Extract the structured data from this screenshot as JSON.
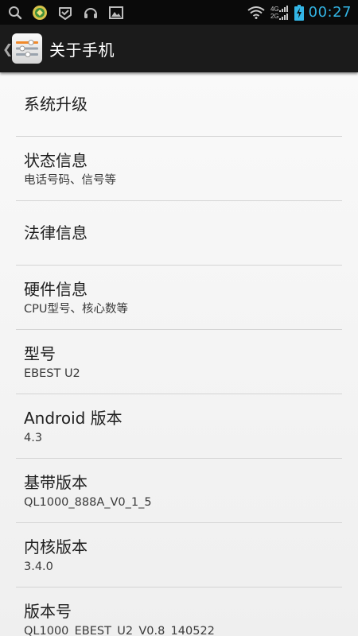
{
  "status_bar": {
    "left_icons": [
      "search-icon",
      "app-notification-icon",
      "mail-check-icon",
      "headset-icon",
      "gallery-icon"
    ],
    "network": {
      "line1": "4G",
      "line2": "2G"
    },
    "time": "00:27",
    "accent_color": "#33b5e5"
  },
  "action_bar": {
    "title": "关于手机",
    "up_chevron": "❮",
    "background": "#1b1b1b"
  },
  "settings": {
    "items": [
      {
        "title": "系统升级",
        "summary": ""
      },
      {
        "title": "状态信息",
        "summary": "电话号码、信号等"
      },
      {
        "title": "法律信息",
        "summary": ""
      },
      {
        "title": "硬件信息",
        "summary": "CPU型号、核心数等"
      },
      {
        "title": "型号",
        "summary": "EBEST U2"
      },
      {
        "title": "Android 版本",
        "summary": "4.3"
      },
      {
        "title": "基带版本",
        "summary": "QL1000_888A_V0_1_5"
      },
      {
        "title": "内核版本",
        "summary": "3.4.0"
      },
      {
        "title": "版本号",
        "summary": "QL1000_EBEST_U2_V0.8_140522"
      }
    ]
  }
}
